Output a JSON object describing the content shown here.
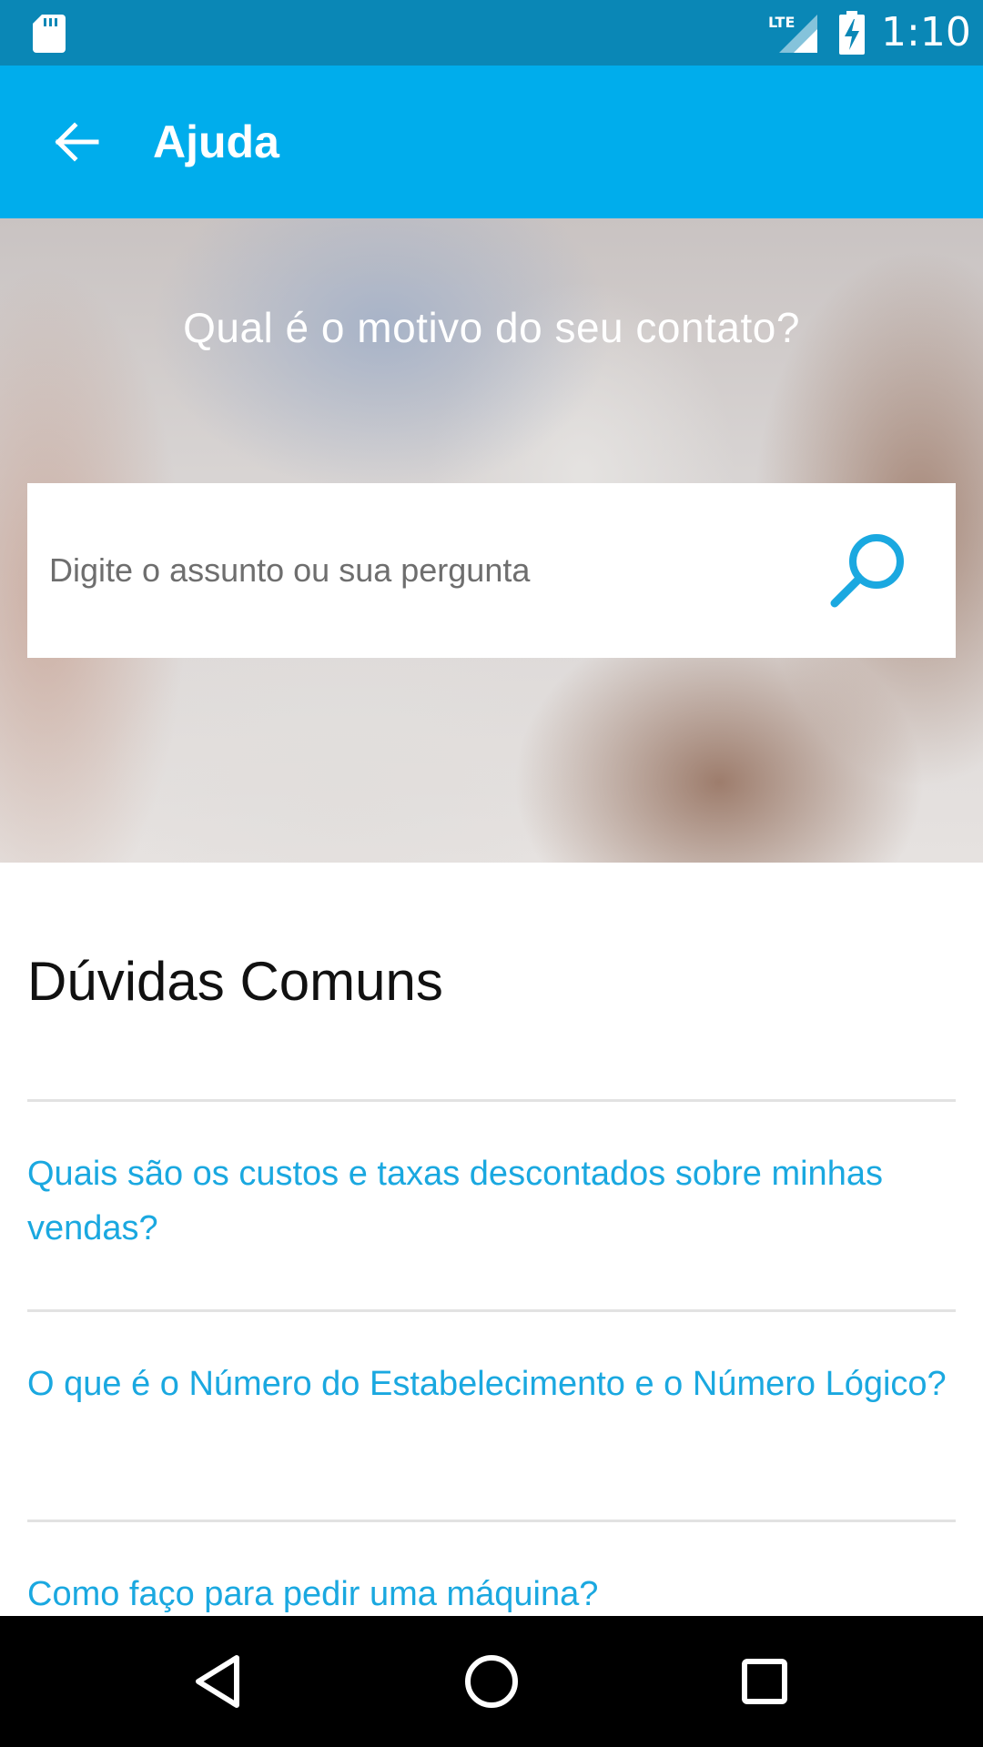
{
  "status_bar": {
    "time": "1:10",
    "network_label": "LTE",
    "icons": [
      "sd-card-icon",
      "lte-signal-icon",
      "battery-charging-icon"
    ]
  },
  "app_bar": {
    "title": "Ajuda",
    "back_icon": "arrow-left-icon"
  },
  "hero": {
    "question": "Qual é o motivo do seu contato?",
    "search": {
      "placeholder": "Digite o assunto ou sua pergunta",
      "value": "",
      "icon": "search-icon"
    }
  },
  "faq": {
    "title": "Dúvidas Comuns",
    "items": [
      {
        "label": "Quais são os custos e taxas descontados sobre minhas vendas?"
      },
      {
        "label": "O que é o Número do Estabelecimento e o Número Lógico?"
      },
      {
        "label": "Como faço para pedir uma máquina?"
      }
    ]
  },
  "nav_bar": {
    "buttons": [
      "back-triangle-icon",
      "home-circle-icon",
      "recents-square-icon"
    ]
  },
  "colors": {
    "status_bar": "#0a87b6",
    "app_bar": "#00adec",
    "link": "#1aa8e0",
    "divider": "#e2e2e2"
  }
}
